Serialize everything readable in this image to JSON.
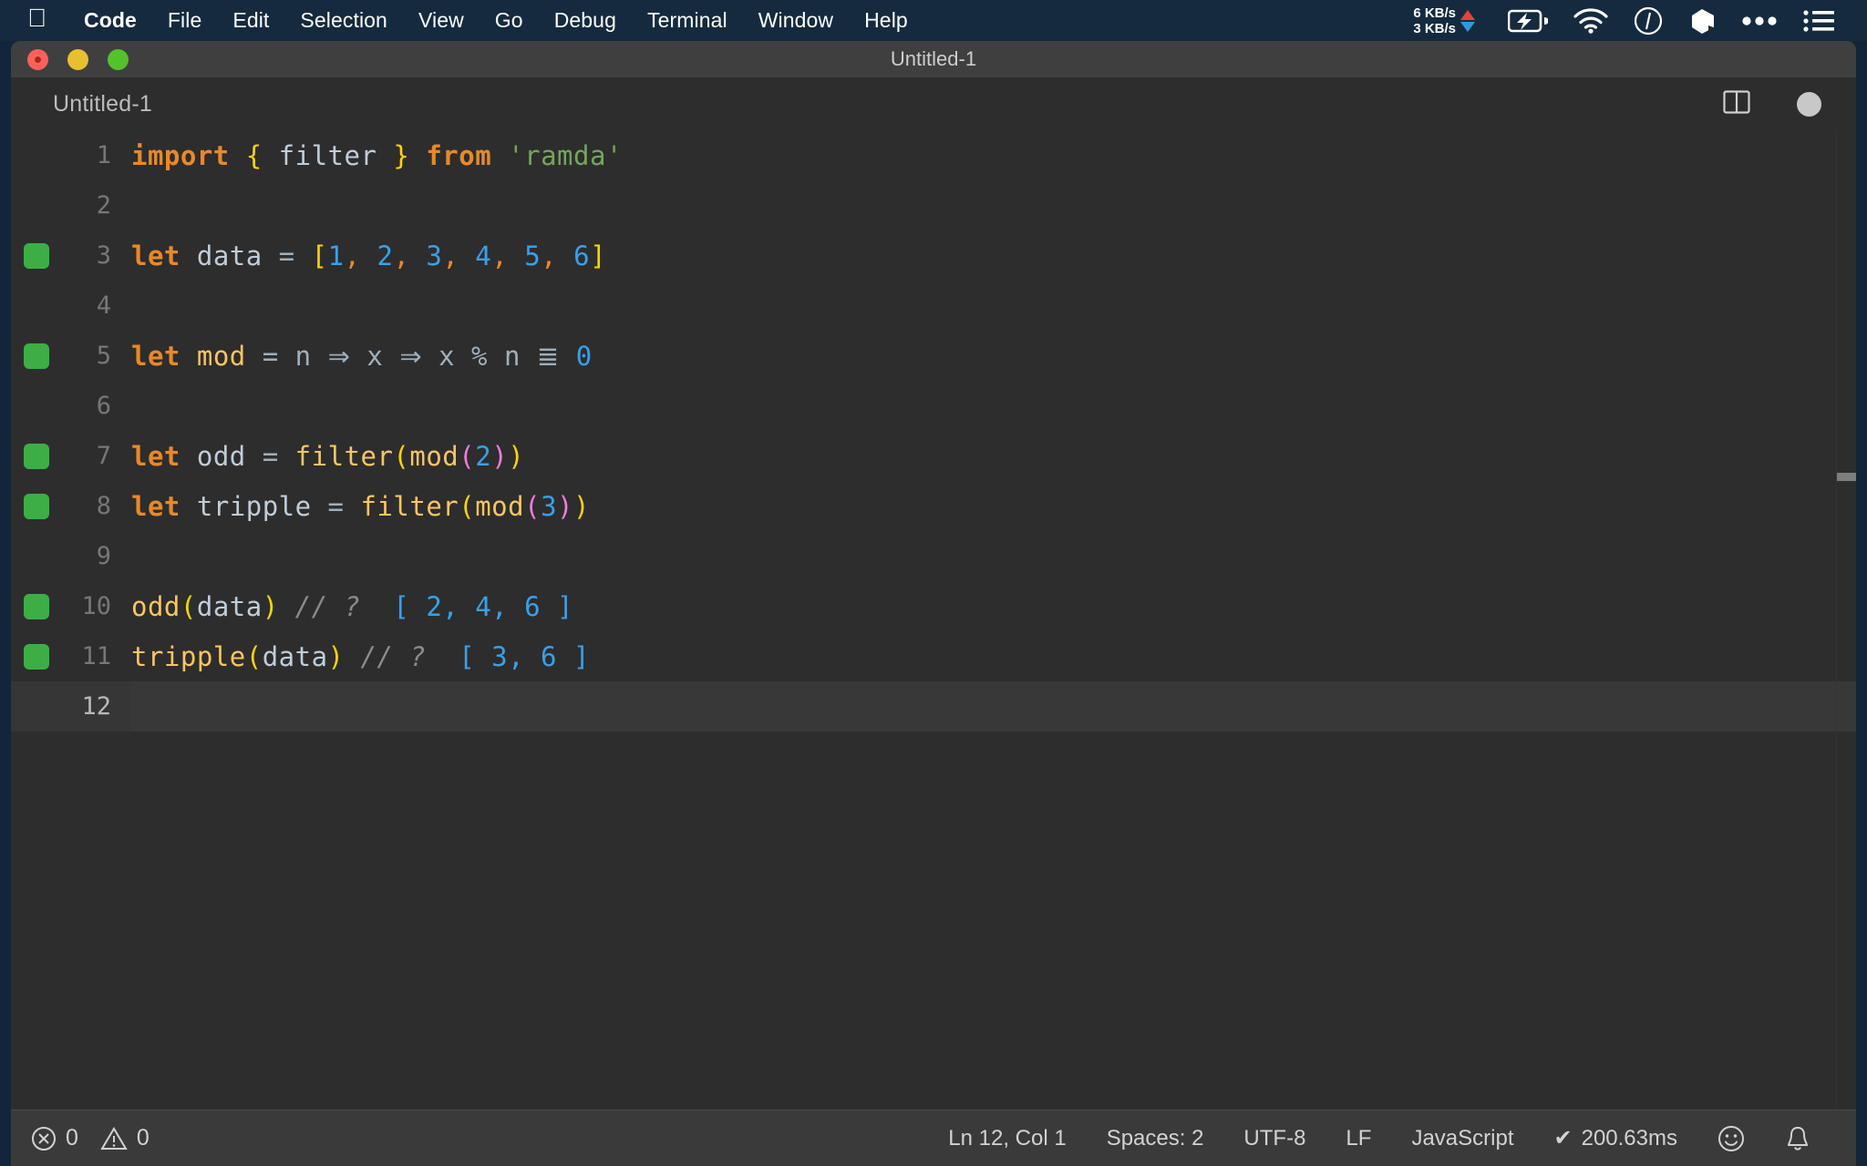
{
  "menubar": {
    "apple_icon": "apple-logo-icon",
    "items": [
      {
        "label": "Code",
        "bold": true
      },
      {
        "label": "File",
        "bold": false
      },
      {
        "label": "Edit",
        "bold": false
      },
      {
        "label": "Selection",
        "bold": false
      },
      {
        "label": "View",
        "bold": false
      },
      {
        "label": "Go",
        "bold": false
      },
      {
        "label": "Debug",
        "bold": false
      },
      {
        "label": "Terminal",
        "bold": false
      },
      {
        "label": "Window",
        "bold": false
      },
      {
        "label": "Help",
        "bold": false
      }
    ],
    "network": {
      "upload": "6 KB/s",
      "download": "3 KB/s",
      "upload_color": "#e8413a",
      "download_color": "#2e9ae0"
    },
    "status_icons": [
      "battery-charging-icon",
      "wifi-icon",
      "clock-icon",
      "dropbox-icon",
      "ellipsis-icon",
      "list-menu-icon"
    ],
    "background_color": "#152a3f"
  },
  "window": {
    "title": "Untitled-1",
    "traffic_lights": [
      "close-button",
      "minimize-button",
      "maximize-button"
    ],
    "titlebar_color": "#3f3f3f"
  },
  "tabbar": {
    "active_tab": "Untitled-1",
    "split_editor_icon": "split-editor-icon",
    "unsaved_indicator": "unsaved-changes-dot"
  },
  "editor": {
    "background_color": "#2d2d2d",
    "current_line": 12,
    "language": "JavaScript",
    "lines": [
      {
        "number": "1",
        "marker": false,
        "tokens": [
          {
            "text": "import",
            "cls": "t-kw"
          },
          {
            "text": " ",
            "cls": "t-plain"
          },
          {
            "text": "{",
            "cls": "t-brkt-y"
          },
          {
            "text": " ",
            "cls": "t-plain"
          },
          {
            "text": "filter",
            "cls": "t-var"
          },
          {
            "text": " ",
            "cls": "t-plain"
          },
          {
            "text": "}",
            "cls": "t-brkt-y"
          },
          {
            "text": " ",
            "cls": "t-plain"
          },
          {
            "text": "from",
            "cls": "t-kw"
          },
          {
            "text": " ",
            "cls": "t-plain"
          },
          {
            "text": "'ramda'",
            "cls": "t-str"
          }
        ]
      },
      {
        "number": "2",
        "marker": false,
        "tokens": []
      },
      {
        "number": "3",
        "marker": true,
        "tokens": [
          {
            "text": "let",
            "cls": "t-kw"
          },
          {
            "text": " ",
            "cls": "t-plain"
          },
          {
            "text": "data",
            "cls": "t-var"
          },
          {
            "text": " ",
            "cls": "t-plain"
          },
          {
            "text": "=",
            "cls": "t-op"
          },
          {
            "text": " ",
            "cls": "t-plain"
          },
          {
            "text": "[",
            "cls": "t-brkt-y"
          },
          {
            "text": "1",
            "cls": "t-num"
          },
          {
            "text": ",",
            "cls": "t-comma"
          },
          {
            "text": " ",
            "cls": "t-plain"
          },
          {
            "text": "2",
            "cls": "t-num"
          },
          {
            "text": ",",
            "cls": "t-comma"
          },
          {
            "text": " ",
            "cls": "t-plain"
          },
          {
            "text": "3",
            "cls": "t-num"
          },
          {
            "text": ",",
            "cls": "t-comma"
          },
          {
            "text": " ",
            "cls": "t-plain"
          },
          {
            "text": "4",
            "cls": "t-num"
          },
          {
            "text": ",",
            "cls": "t-comma"
          },
          {
            "text": " ",
            "cls": "t-plain"
          },
          {
            "text": "5",
            "cls": "t-num"
          },
          {
            "text": ",",
            "cls": "t-comma"
          },
          {
            "text": " ",
            "cls": "t-plain"
          },
          {
            "text": "6",
            "cls": "t-num"
          },
          {
            "text": "]",
            "cls": "t-brkt-y"
          }
        ]
      },
      {
        "number": "4",
        "marker": false,
        "tokens": []
      },
      {
        "number": "5",
        "marker": true,
        "tokens": [
          {
            "text": "let",
            "cls": "t-kw"
          },
          {
            "text": " ",
            "cls": "t-plain"
          },
          {
            "text": "mod",
            "cls": "t-fn"
          },
          {
            "text": " ",
            "cls": "t-plain"
          },
          {
            "text": "=",
            "cls": "t-op"
          },
          {
            "text": " ",
            "cls": "t-plain"
          },
          {
            "text": "n",
            "cls": "t-op"
          },
          {
            "text": " ",
            "cls": "t-plain"
          },
          {
            "text": "⇒",
            "cls": "lig"
          },
          {
            "text": " ",
            "cls": "t-plain"
          },
          {
            "text": "x",
            "cls": "t-op"
          },
          {
            "text": " ",
            "cls": "t-plain"
          },
          {
            "text": "⇒",
            "cls": "lig"
          },
          {
            "text": " ",
            "cls": "t-plain"
          },
          {
            "text": "x",
            "cls": "t-op"
          },
          {
            "text": " ",
            "cls": "t-plain"
          },
          {
            "text": "%",
            "cls": "t-op"
          },
          {
            "text": " ",
            "cls": "t-plain"
          },
          {
            "text": "n",
            "cls": "t-op"
          },
          {
            "text": " ",
            "cls": "t-plain"
          },
          {
            "text": "≣",
            "cls": "lig"
          },
          {
            "text": " ",
            "cls": "t-plain"
          },
          {
            "text": "0",
            "cls": "t-num"
          }
        ]
      },
      {
        "number": "6",
        "marker": false,
        "tokens": []
      },
      {
        "number": "7",
        "marker": true,
        "tokens": [
          {
            "text": "let",
            "cls": "t-kw"
          },
          {
            "text": " ",
            "cls": "t-plain"
          },
          {
            "text": "odd",
            "cls": "t-var"
          },
          {
            "text": " ",
            "cls": "t-plain"
          },
          {
            "text": "=",
            "cls": "t-op"
          },
          {
            "text": " ",
            "cls": "t-plain"
          },
          {
            "text": "filter",
            "cls": "t-fn"
          },
          {
            "text": "(",
            "cls": "t-brkt-y"
          },
          {
            "text": "mod",
            "cls": "t-fn"
          },
          {
            "text": "(",
            "cls": "t-brkt-m"
          },
          {
            "text": "2",
            "cls": "t-num"
          },
          {
            "text": ")",
            "cls": "t-brkt-m"
          },
          {
            "text": ")",
            "cls": "t-brkt-y"
          }
        ]
      },
      {
        "number": "8",
        "marker": true,
        "tokens": [
          {
            "text": "let",
            "cls": "t-kw"
          },
          {
            "text": " ",
            "cls": "t-plain"
          },
          {
            "text": "tripple",
            "cls": "t-var"
          },
          {
            "text": " ",
            "cls": "t-plain"
          },
          {
            "text": "=",
            "cls": "t-op"
          },
          {
            "text": " ",
            "cls": "t-plain"
          },
          {
            "text": "filter",
            "cls": "t-fn"
          },
          {
            "text": "(",
            "cls": "t-brkt-y"
          },
          {
            "text": "mod",
            "cls": "t-fn"
          },
          {
            "text": "(",
            "cls": "t-brkt-m"
          },
          {
            "text": "3",
            "cls": "t-num"
          },
          {
            "text": ")",
            "cls": "t-brkt-m"
          },
          {
            "text": ")",
            "cls": "t-brkt-y"
          }
        ]
      },
      {
        "number": "9",
        "marker": false,
        "tokens": []
      },
      {
        "number": "10",
        "marker": true,
        "tokens": [
          {
            "text": "odd",
            "cls": "t-fn"
          },
          {
            "text": "(",
            "cls": "t-brkt-y"
          },
          {
            "text": "data",
            "cls": "t-var"
          },
          {
            "text": ")",
            "cls": "t-brkt-y"
          },
          {
            "text": " ",
            "cls": "t-plain"
          },
          {
            "text": "// ?",
            "cls": "t-comment"
          },
          {
            "text": "  ",
            "cls": "t-plain"
          },
          {
            "text": "[ 2, 4, 6 ]",
            "cls": "t-result"
          }
        ]
      },
      {
        "number": "11",
        "marker": true,
        "tokens": [
          {
            "text": "tripple",
            "cls": "t-fn"
          },
          {
            "text": "(",
            "cls": "t-brkt-y"
          },
          {
            "text": "data",
            "cls": "t-var"
          },
          {
            "text": ")",
            "cls": "t-brkt-y"
          },
          {
            "text": " ",
            "cls": "t-plain"
          },
          {
            "text": "// ?",
            "cls": "t-comment"
          },
          {
            "text": "  ",
            "cls": "t-plain"
          },
          {
            "text": "[ 3, 6 ]",
            "cls": "t-result"
          }
        ]
      },
      {
        "number": "12",
        "marker": false,
        "tokens": [],
        "current": true
      }
    ]
  },
  "statusbar": {
    "error_icon": "error-circle-icon",
    "error_count": "0",
    "warning_icon": "warning-triangle-icon",
    "warning_count": "0",
    "cursor_position": "Ln 12, Col 1",
    "indentation": "Spaces: 2",
    "encoding": "UTF-8",
    "eol": "LF",
    "language_mode": "JavaScript",
    "quokka_check": "✔",
    "quokka_time": "200.63ms",
    "feedback_icon": "smiley-icon",
    "notification_icon": "bell-icon",
    "background_color": "#3a3a3a"
  }
}
